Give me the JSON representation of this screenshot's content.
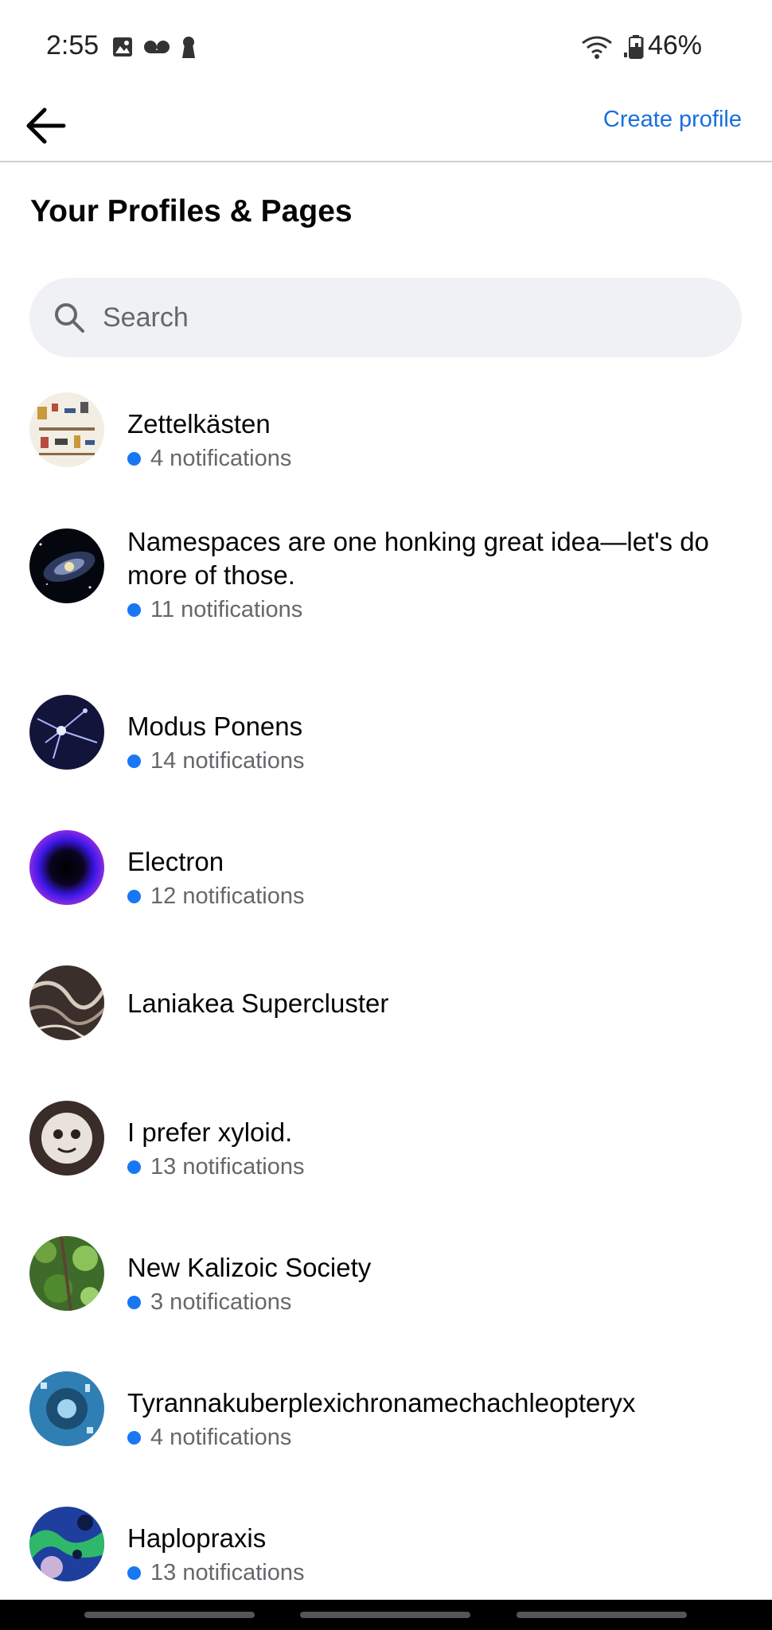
{
  "status_bar": {
    "time": "2:55",
    "battery_percent": "46%",
    "icons": [
      "image-icon",
      "voicemail-icon",
      "keyhole-icon",
      "wifi-icon",
      "signal-icon",
      "battery-icon"
    ]
  },
  "header": {
    "back_icon": "arrow-left-icon",
    "create_profile_label": "Create profile"
  },
  "page_title": "Your Profiles & Pages",
  "search": {
    "placeholder": "Search",
    "value": ""
  },
  "colors": {
    "accent": "#1a6fe0",
    "notification_dot": "#1877f2",
    "search_bg": "#eff1f4",
    "secondary_text": "#65676b"
  },
  "profiles": [
    {
      "name": "Zettelkästen",
      "notifications": "4 notifications"
    },
    {
      "name": "Namespaces are one honking great idea—let's do more of those.",
      "notifications": "11 notifications"
    },
    {
      "name": "Modus Ponens",
      "notifications": "14 notifications"
    },
    {
      "name": "Electron",
      "notifications": "12 notifications"
    },
    {
      "name": "Laniakea Supercluster",
      "notifications": ""
    },
    {
      "name": "I prefer xyloid.",
      "notifications": "13 notifications"
    },
    {
      "name": "New Kalizoic Society",
      "notifications": "3 notifications"
    },
    {
      "name": "Tyrannakuberplexichronamechachleopteryx",
      "notifications": "4 notifications"
    },
    {
      "name": "Haplopraxis",
      "notifications": "13 notifications"
    }
  ]
}
